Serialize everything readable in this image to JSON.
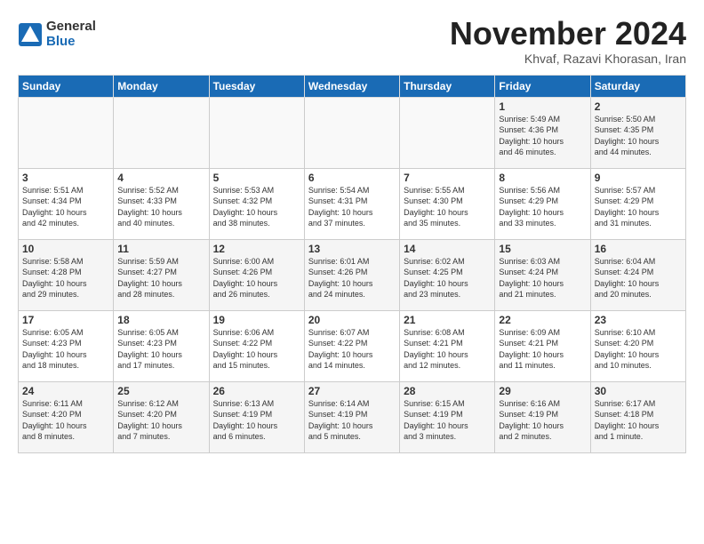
{
  "logo": {
    "general": "General",
    "blue": "Blue"
  },
  "title": "November 2024",
  "subtitle": "Khvaf, Razavi Khorasan, Iran",
  "days_header": [
    "Sunday",
    "Monday",
    "Tuesday",
    "Wednesday",
    "Thursday",
    "Friday",
    "Saturday"
  ],
  "weeks": [
    [
      {
        "day": "",
        "info": ""
      },
      {
        "day": "",
        "info": ""
      },
      {
        "day": "",
        "info": ""
      },
      {
        "day": "",
        "info": ""
      },
      {
        "day": "",
        "info": ""
      },
      {
        "day": "1",
        "info": "Sunrise: 5:49 AM\nSunset: 4:36 PM\nDaylight: 10 hours\nand 46 minutes."
      },
      {
        "day": "2",
        "info": "Sunrise: 5:50 AM\nSunset: 4:35 PM\nDaylight: 10 hours\nand 44 minutes."
      }
    ],
    [
      {
        "day": "3",
        "info": "Sunrise: 5:51 AM\nSunset: 4:34 PM\nDaylight: 10 hours\nand 42 minutes."
      },
      {
        "day": "4",
        "info": "Sunrise: 5:52 AM\nSunset: 4:33 PM\nDaylight: 10 hours\nand 40 minutes."
      },
      {
        "day": "5",
        "info": "Sunrise: 5:53 AM\nSunset: 4:32 PM\nDaylight: 10 hours\nand 38 minutes."
      },
      {
        "day": "6",
        "info": "Sunrise: 5:54 AM\nSunset: 4:31 PM\nDaylight: 10 hours\nand 37 minutes."
      },
      {
        "day": "7",
        "info": "Sunrise: 5:55 AM\nSunset: 4:30 PM\nDaylight: 10 hours\nand 35 minutes."
      },
      {
        "day": "8",
        "info": "Sunrise: 5:56 AM\nSunset: 4:29 PM\nDaylight: 10 hours\nand 33 minutes."
      },
      {
        "day": "9",
        "info": "Sunrise: 5:57 AM\nSunset: 4:29 PM\nDaylight: 10 hours\nand 31 minutes."
      }
    ],
    [
      {
        "day": "10",
        "info": "Sunrise: 5:58 AM\nSunset: 4:28 PM\nDaylight: 10 hours\nand 29 minutes."
      },
      {
        "day": "11",
        "info": "Sunrise: 5:59 AM\nSunset: 4:27 PM\nDaylight: 10 hours\nand 28 minutes."
      },
      {
        "day": "12",
        "info": "Sunrise: 6:00 AM\nSunset: 4:26 PM\nDaylight: 10 hours\nand 26 minutes."
      },
      {
        "day": "13",
        "info": "Sunrise: 6:01 AM\nSunset: 4:26 PM\nDaylight: 10 hours\nand 24 minutes."
      },
      {
        "day": "14",
        "info": "Sunrise: 6:02 AM\nSunset: 4:25 PM\nDaylight: 10 hours\nand 23 minutes."
      },
      {
        "day": "15",
        "info": "Sunrise: 6:03 AM\nSunset: 4:24 PM\nDaylight: 10 hours\nand 21 minutes."
      },
      {
        "day": "16",
        "info": "Sunrise: 6:04 AM\nSunset: 4:24 PM\nDaylight: 10 hours\nand 20 minutes."
      }
    ],
    [
      {
        "day": "17",
        "info": "Sunrise: 6:05 AM\nSunset: 4:23 PM\nDaylight: 10 hours\nand 18 minutes."
      },
      {
        "day": "18",
        "info": "Sunrise: 6:05 AM\nSunset: 4:23 PM\nDaylight: 10 hours\nand 17 minutes."
      },
      {
        "day": "19",
        "info": "Sunrise: 6:06 AM\nSunset: 4:22 PM\nDaylight: 10 hours\nand 15 minutes."
      },
      {
        "day": "20",
        "info": "Sunrise: 6:07 AM\nSunset: 4:22 PM\nDaylight: 10 hours\nand 14 minutes."
      },
      {
        "day": "21",
        "info": "Sunrise: 6:08 AM\nSunset: 4:21 PM\nDaylight: 10 hours\nand 12 minutes."
      },
      {
        "day": "22",
        "info": "Sunrise: 6:09 AM\nSunset: 4:21 PM\nDaylight: 10 hours\nand 11 minutes."
      },
      {
        "day": "23",
        "info": "Sunrise: 6:10 AM\nSunset: 4:20 PM\nDaylight: 10 hours\nand 10 minutes."
      }
    ],
    [
      {
        "day": "24",
        "info": "Sunrise: 6:11 AM\nSunset: 4:20 PM\nDaylight: 10 hours\nand 8 minutes."
      },
      {
        "day": "25",
        "info": "Sunrise: 6:12 AM\nSunset: 4:20 PM\nDaylight: 10 hours\nand 7 minutes."
      },
      {
        "day": "26",
        "info": "Sunrise: 6:13 AM\nSunset: 4:19 PM\nDaylight: 10 hours\nand 6 minutes."
      },
      {
        "day": "27",
        "info": "Sunrise: 6:14 AM\nSunset: 4:19 PM\nDaylight: 10 hours\nand 5 minutes."
      },
      {
        "day": "28",
        "info": "Sunrise: 6:15 AM\nSunset: 4:19 PM\nDaylight: 10 hours\nand 3 minutes."
      },
      {
        "day": "29",
        "info": "Sunrise: 6:16 AM\nSunset: 4:19 PM\nDaylight: 10 hours\nand 2 minutes."
      },
      {
        "day": "30",
        "info": "Sunrise: 6:17 AM\nSunset: 4:18 PM\nDaylight: 10 hours\nand 1 minute."
      }
    ]
  ]
}
